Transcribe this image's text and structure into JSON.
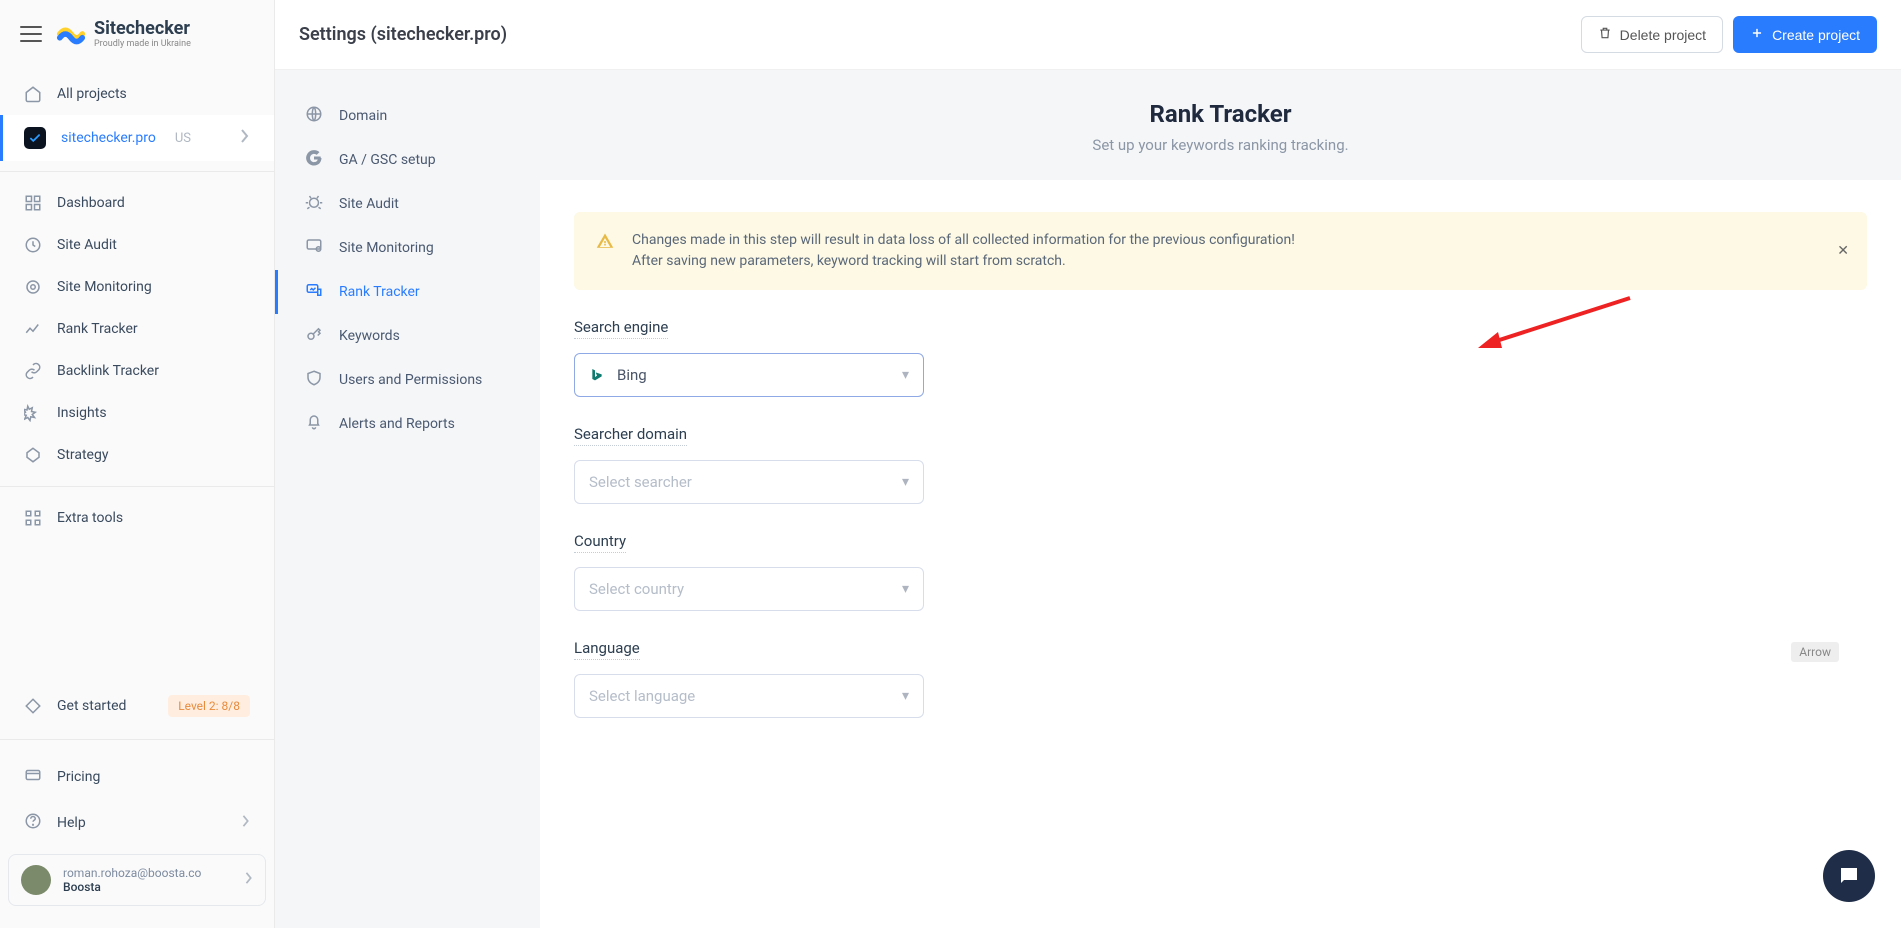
{
  "brand": {
    "name": "Sitechecker",
    "tagline": "Proudly made in Ukraine"
  },
  "sidebar": {
    "all_projects": "All projects",
    "project": {
      "name": "sitechecker.pro",
      "tag": "US"
    },
    "items": [
      {
        "label": "Dashboard"
      },
      {
        "label": "Site Audit"
      },
      {
        "label": "Site Monitoring"
      },
      {
        "label": "Rank Tracker"
      },
      {
        "label": "Backlink Tracker"
      },
      {
        "label": "Insights"
      },
      {
        "label": "Strategy"
      }
    ],
    "extra_tools": "Extra tools",
    "get_started": "Get started",
    "level_badge": "Level 2: 8/8",
    "pricing": "Pricing",
    "help": "Help"
  },
  "user": {
    "email": "roman.rohoza@boosta.co",
    "org": "Boosta"
  },
  "topbar": {
    "title": "Settings (sitechecker.pro)",
    "delete": "Delete project",
    "create": "Create project"
  },
  "subnav": {
    "items": [
      {
        "label": "Domain"
      },
      {
        "label": "GA / GSC setup"
      },
      {
        "label": "Site Audit"
      },
      {
        "label": "Site Monitoring"
      },
      {
        "label": "Rank Tracker"
      },
      {
        "label": "Keywords"
      },
      {
        "label": "Users and Permissions"
      },
      {
        "label": "Alerts and Reports"
      }
    ]
  },
  "panel": {
    "title": "Rank Tracker",
    "subtitle": "Set up your keywords ranking tracking."
  },
  "alert": {
    "line1": "Changes made in this step will result in data loss of all collected information for the previous configuration!",
    "line2": "After saving new parameters, keyword tracking will start from scratch."
  },
  "fields": {
    "search_engine": {
      "label": "Search engine",
      "value": "Bing"
    },
    "searcher_domain": {
      "label": "Searcher domain",
      "placeholder": "Select searcher"
    },
    "country": {
      "label": "Country",
      "placeholder": "Select country"
    },
    "language": {
      "label": "Language",
      "placeholder": "Select language"
    }
  },
  "annotation": {
    "arrow_tag": "Arrow"
  }
}
